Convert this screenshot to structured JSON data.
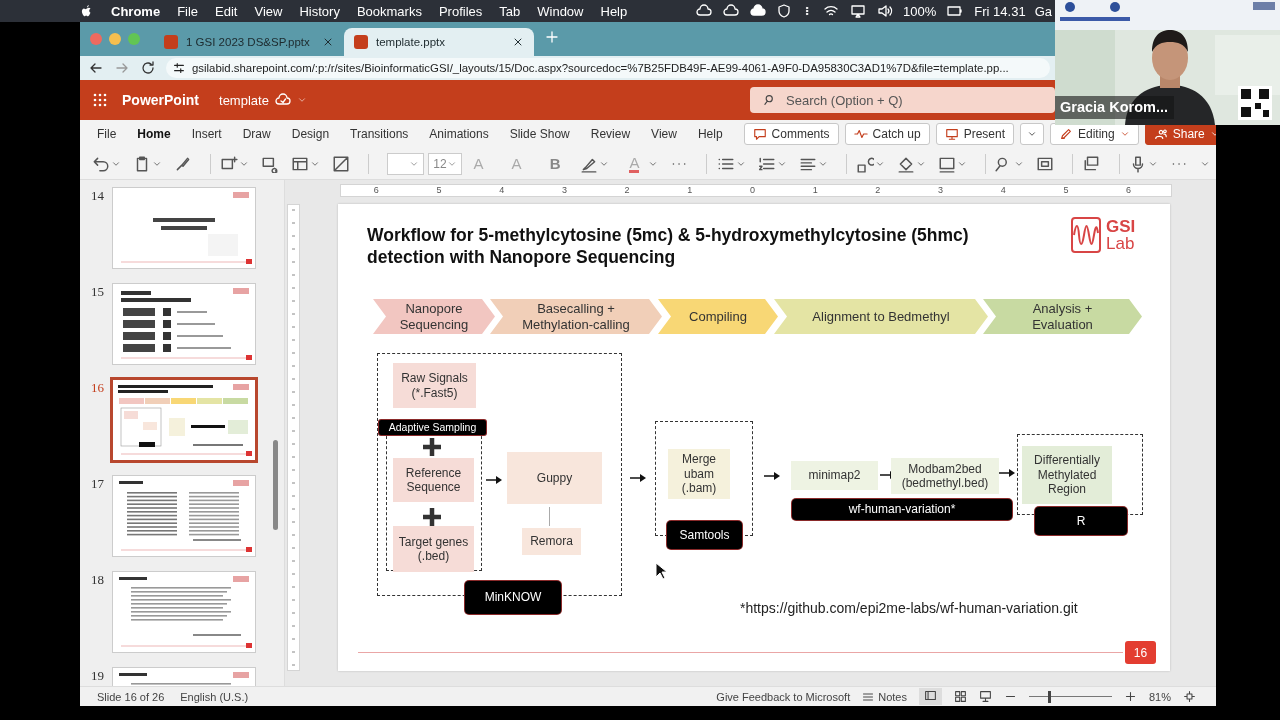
{
  "menubar": {
    "app": "Chrome",
    "menus": [
      "File",
      "Edit",
      "View",
      "History",
      "Bookmarks",
      "Profiles",
      "Tab",
      "Window",
      "Help"
    ],
    "battery": "100%",
    "clock": "Fri 14.31",
    "user": "Ga"
  },
  "browser": {
    "tabs": [
      {
        "title": "1 GSI 2023 DS&SP.pptx",
        "selected": false
      },
      {
        "title": "template.pptx",
        "selected": true
      }
    ],
    "url": "gsilabid.sharepoint.com/:p:/r/sites/BioinformaticGSI/_layouts/15/Doc.aspx?sourcedoc=%7B25FDB49F-AE99-4061-A9F0-DA95830C3AD1%7D&file=template.pp..."
  },
  "app_bar": {
    "app_name": "PowerPoint",
    "document": "template",
    "search": {
      "placeholder": "Search (Option + Q)"
    }
  },
  "ribbon": {
    "tabs": [
      {
        "label": "File",
        "selected": false
      },
      {
        "label": "Home",
        "selected": true
      },
      {
        "label": "Insert",
        "selected": false
      },
      {
        "label": "Draw",
        "selected": false
      },
      {
        "label": "Design",
        "selected": false
      },
      {
        "label": "Transitions",
        "selected": false
      },
      {
        "label": "Animations",
        "selected": false
      },
      {
        "label": "Slide Show",
        "selected": false
      },
      {
        "label": "Review",
        "selected": false
      },
      {
        "label": "View",
        "selected": false
      },
      {
        "label": "Help",
        "selected": false
      }
    ],
    "actions": [
      "Comments",
      "Catch up",
      "Present",
      "Editing",
      "Share"
    ]
  },
  "toolbar": {
    "font_size": "12",
    "glyphs": [
      "A",
      "A",
      "B",
      "A"
    ]
  },
  "ruler": [
    "6",
    "5",
    "4",
    "3",
    "2",
    "1",
    "0",
    "1",
    "2",
    "3",
    "4",
    "5",
    "6"
  ],
  "thumbnails": [
    {
      "number": "14",
      "kind": "title",
      "selected": false
    },
    {
      "number": "15",
      "kind": "list",
      "selected": false
    },
    {
      "number": "16",
      "kind": "diagram",
      "selected": true
    },
    {
      "number": "17",
      "kind": "table",
      "selected": false
    },
    {
      "number": "18",
      "kind": "text",
      "selected": false
    },
    {
      "number": "19",
      "kind": "text",
      "selected": false
    }
  ],
  "slide": {
    "title": "Workflow for 5-methylcytosine (5mc) & 5-hydroxymethylcytosine (5hmc)\ndetection with Nanopore Sequencing",
    "logo": {
      "line_1": "GSI",
      "line_2": "Lab"
    },
    "steps": [
      {
        "label": "Nanopore\nSequencing",
        "color": "#f2c6c1"
      },
      {
        "label": "Basecalling +\nMethylation-calling",
        "color": "#f1cfb8"
      },
      {
        "label": "Compiling",
        "color": "#f8d775"
      },
      {
        "label": "Alignment to Bedmethyl",
        "color": "#e4e4a4"
      },
      {
        "label": "Analysis +\nEvaluation",
        "color": "#c8daa2"
      }
    ],
    "nodes": [
      {
        "text": "Raw Signals\n(*.Fast5)",
        "kind": "box",
        "color": "#f6dcd7"
      },
      {
        "text": "Adaptive Sampling",
        "kind": "label"
      },
      {
        "text": "Reference\nSequence",
        "kind": "box",
        "color": "#f6dcd7"
      },
      {
        "text": "Target genes\n(.bed)",
        "kind": "box",
        "color": "#f6dcd7"
      },
      {
        "text": "Guppy",
        "kind": "box",
        "color": "#f8e6dc"
      },
      {
        "text": "Remora",
        "kind": "box",
        "color": "#f8e6dc"
      },
      {
        "text": "MinKNOW",
        "kind": "label"
      },
      {
        "text": "Merge\nubam\n(.bam)",
        "kind": "box",
        "color": "#f5f1dc"
      },
      {
        "text": "Samtools",
        "kind": "label"
      },
      {
        "text": "minimap2",
        "kind": "box",
        "color": "#eef3e3"
      },
      {
        "text": "Modbam2bed\n(bedmethyl.bed)",
        "kind": "box",
        "color": "#eef3e3"
      },
      {
        "text": "wf-human-variation*",
        "kind": "label"
      },
      {
        "text": "Differentially\nMethylated\nRegion",
        "kind": "box",
        "color": "#e3edd8"
      },
      {
        "text": "R",
        "kind": "label"
      }
    ],
    "footnote": "*https://github.com/epi2me-labs/wf-human-variation.git",
    "page_number": "16"
  },
  "status_bar": {
    "slide_position": "Slide 16 of 26",
    "language": "English (U.S.)",
    "feedback": "Give Feedback to Microsoft",
    "notes": "Notes",
    "zoom_slider": {
      "level": 0.24
    },
    "zoom": "81%"
  },
  "video": {
    "name": "Gracia Korom..."
  }
}
